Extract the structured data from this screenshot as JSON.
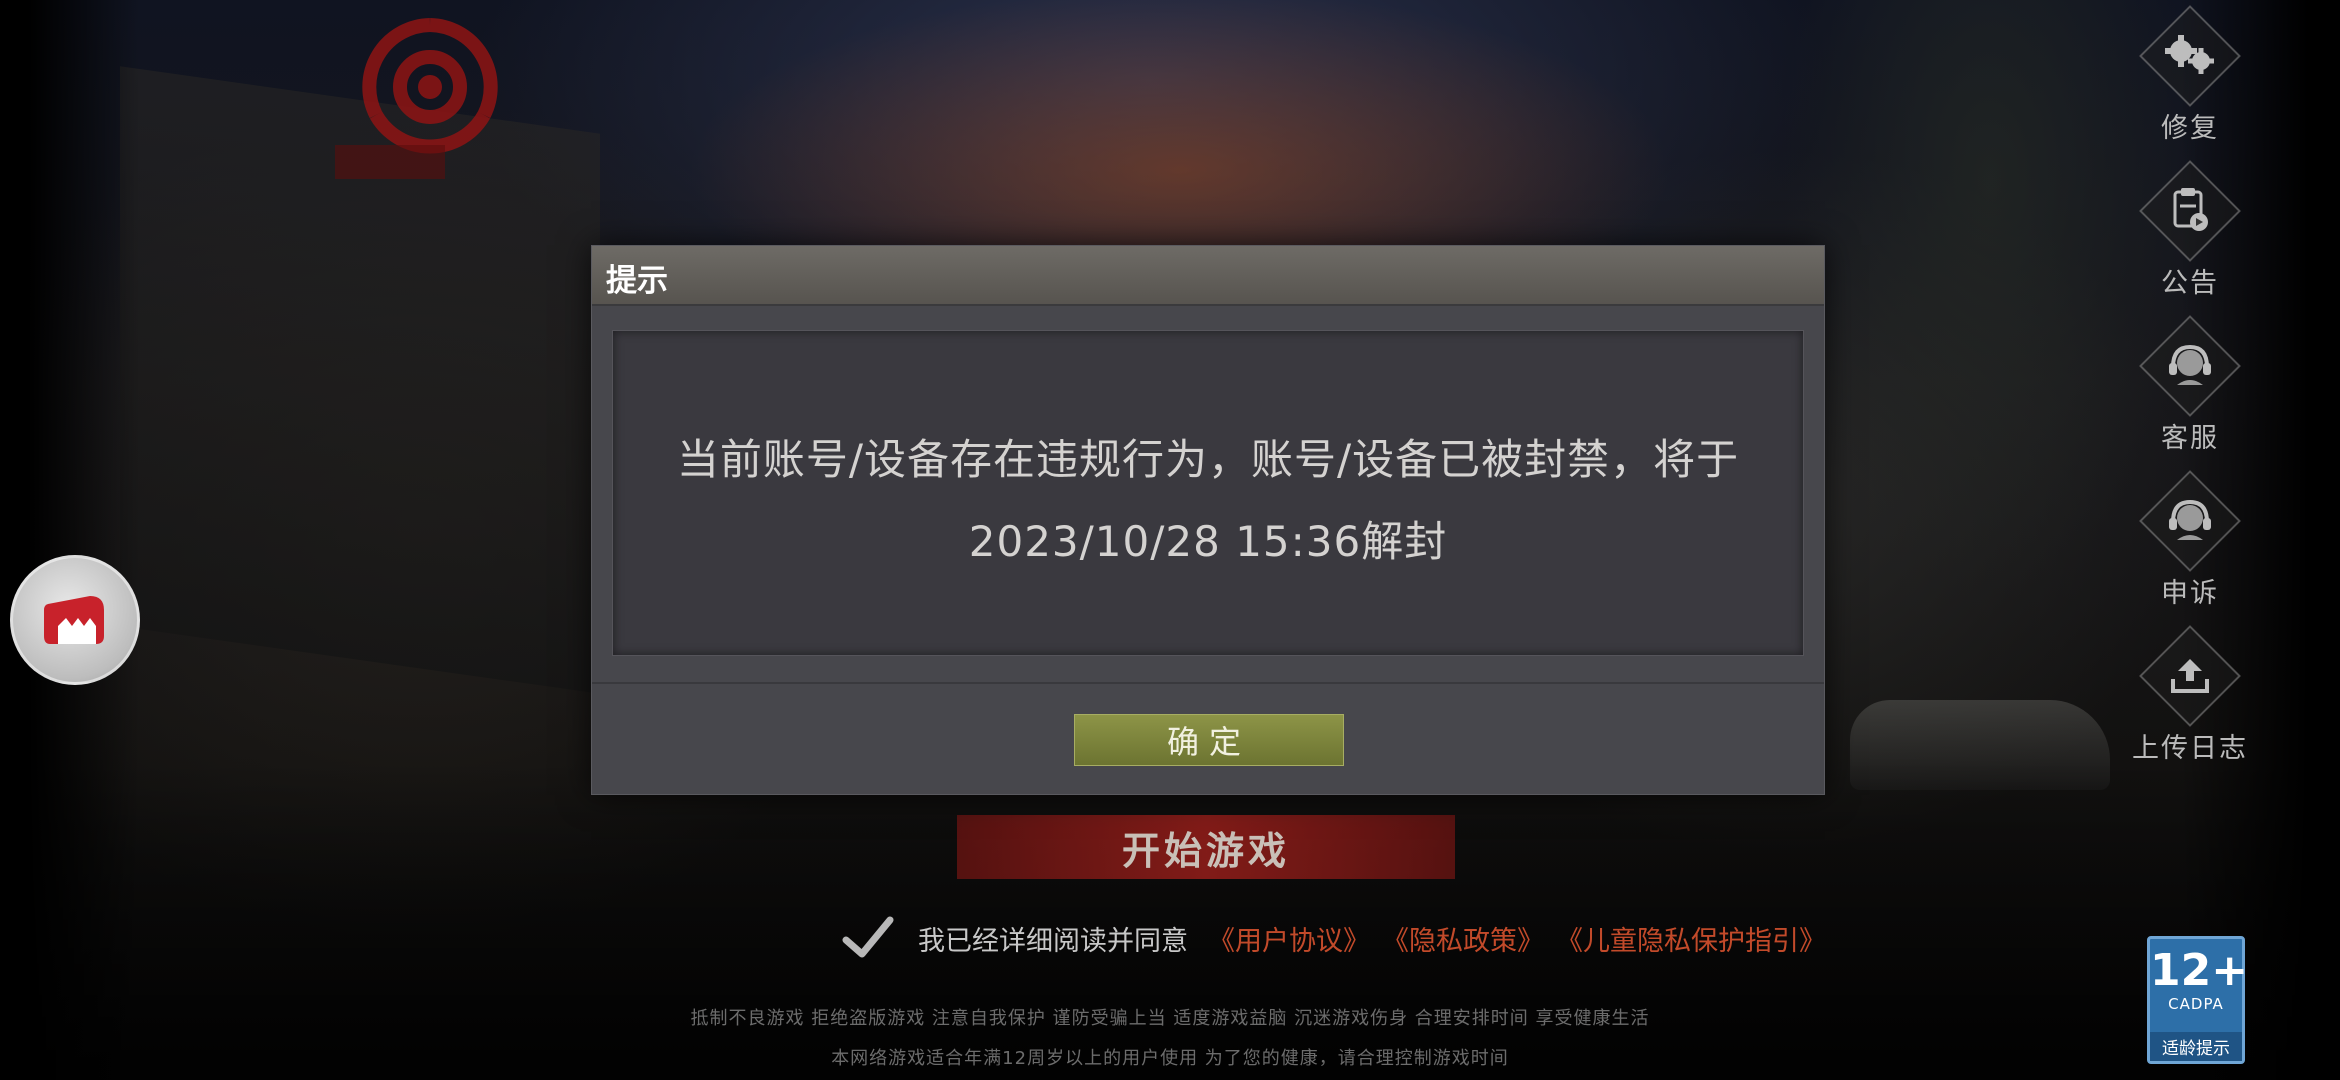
{
  "side_menu": [
    {
      "icon": "gear-icon",
      "label": "修复"
    },
    {
      "icon": "announcement-icon",
      "label": "公告"
    },
    {
      "icon": "headset-icon",
      "label": "客服"
    },
    {
      "icon": "headset-icon",
      "label": "申诉"
    },
    {
      "icon": "upload-icon",
      "label": "上传日志"
    }
  ],
  "start_button": "开始游戏",
  "agreement": {
    "text": "我已经详细阅读并同意",
    "user_agreement": "《用户协议》",
    "privacy_policy": "《隐私政策》",
    "child_privacy": "《儿童隐私保护指引》"
  },
  "health_notice": {
    "line1": "抵制不良游戏 拒绝盗版游戏 注意自我保护 谨防受骗上当 适度游戏益脑 沉迷游戏伤身 合理安排时间 享受健康生活",
    "line2": "本网络游戏适合年满12周岁以上的用户使用 为了您的健康，请合理控制游戏时间"
  },
  "age_badge": {
    "rating": "12+",
    "org": "CADPA",
    "tip": "适龄提示"
  },
  "dialog": {
    "title": "提示",
    "message": "当前账号/设备存在违规行为，账号/设备已被封禁，将于2023/10/28 15:36解封",
    "confirm": "确定"
  },
  "colors": {
    "confirm_button": "#7b8239",
    "start_button": "#8a1c18",
    "link": "#c24a2a",
    "age_badge": "#2d6fa8"
  }
}
